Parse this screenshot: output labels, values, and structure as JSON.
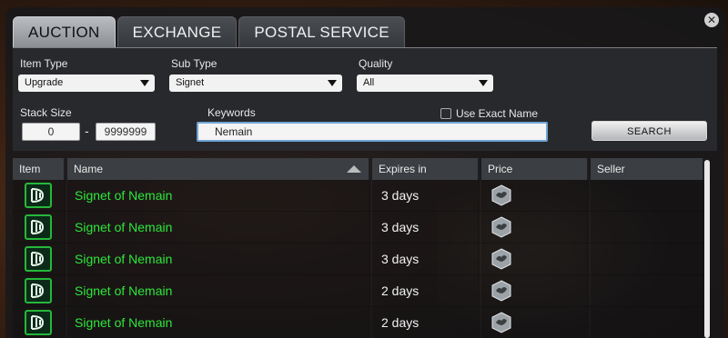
{
  "tabs": [
    {
      "label": "AUCTION",
      "active": true
    },
    {
      "label": "EXCHANGE",
      "active": false
    },
    {
      "label": "POSTAL SERVICE",
      "active": false
    }
  ],
  "close_icon": "close-icon",
  "filters": {
    "item_type_label": "Item Type",
    "item_type_value": "Upgrade",
    "sub_type_label": "Sub Type",
    "sub_type_value": "Signet",
    "quality_label": "Quality",
    "quality_value": "All",
    "stack_size_label": "Stack Size",
    "stack_min": "0",
    "stack_separator": "-",
    "stack_max": "9999999",
    "keywords_label": "Keywords",
    "keywords_value": "Nemain",
    "exact_name_label": "Use Exact Name",
    "exact_name_checked": false,
    "search_label": "SEARCH"
  },
  "table": {
    "headers": {
      "item": "Item",
      "name": "Name",
      "expires": "Expires in",
      "price": "Price",
      "seller": "Seller"
    },
    "rows": [
      {
        "name": "Signet of Nemain",
        "expires": "3 days",
        "icon": "signet-icon",
        "price_icon": "silver-coin-icon"
      },
      {
        "name": "Signet of Nemain",
        "expires": "3 days",
        "icon": "signet-icon",
        "price_icon": "silver-coin-icon"
      },
      {
        "name": "Signet of Nemain",
        "expires": "3 days",
        "icon": "signet-icon",
        "price_icon": "silver-coin-icon"
      },
      {
        "name": "Signet of Nemain",
        "expires": "2 days",
        "icon": "signet-icon",
        "price_icon": "silver-coin-icon"
      },
      {
        "name": "Signet of Nemain",
        "expires": "2 days",
        "icon": "signet-icon",
        "price_icon": "silver-coin-icon"
      }
    ]
  },
  "colors": {
    "item_name": "#2ee63a",
    "icon_border": "#25b83a",
    "active_tab": "#b9bcc0"
  }
}
